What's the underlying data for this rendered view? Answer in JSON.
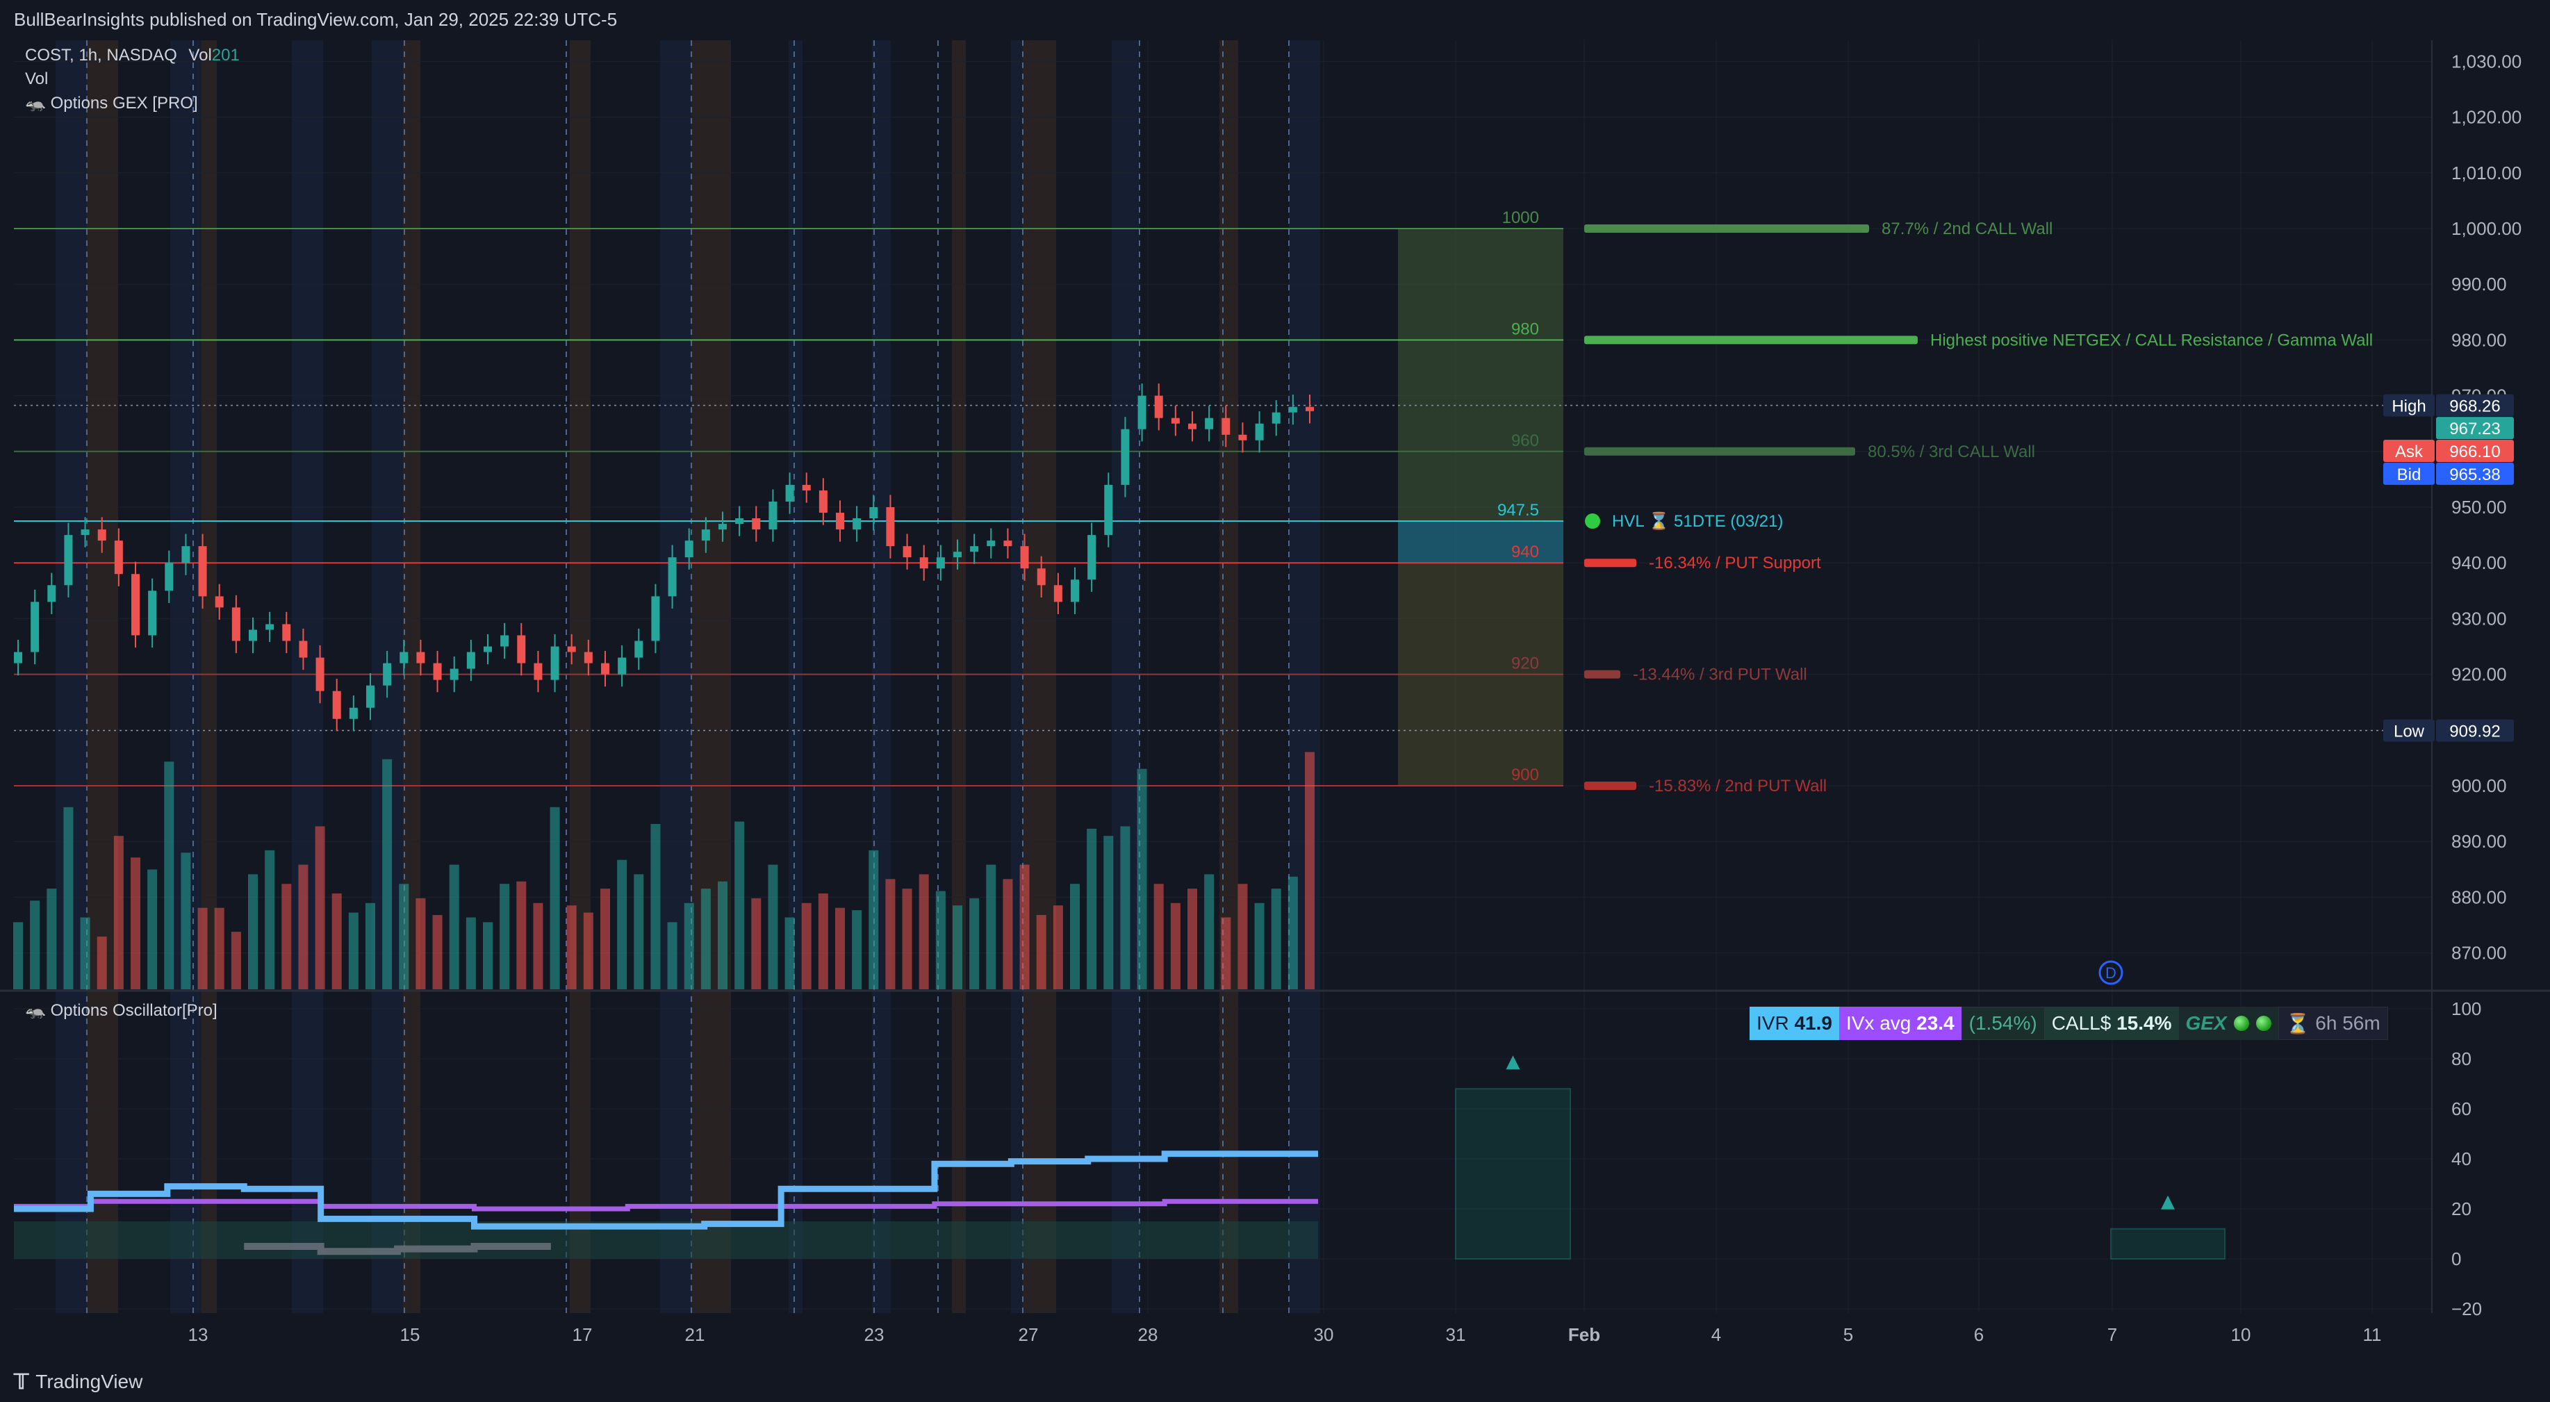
{
  "header": {
    "published_text": "BullBearInsights published on TradingView.com, Jan 29, 2025 22:39 UTC-5"
  },
  "legend": {
    "symbol": "COST, 1h, NASDAQ",
    "vol_label": "Vol",
    "vol_value": "201",
    "vol_line": "Vol",
    "indicator1": "Options GEX [PRO]",
    "indicator2": "Options Oscillator[Pro]"
  },
  "footer": {
    "brand": "TradingView"
  },
  "price_badges": {
    "high_label": "High",
    "high_value": "968.26",
    "last_value": "967.23",
    "ask_label": "Ask",
    "ask_value": "966.10",
    "bid_label": "Bid",
    "bid_value": "965.38",
    "low_label": "Low",
    "low_value": "909.92"
  },
  "gex_levels": [
    {
      "price": 1000,
      "label": "1000",
      "note": "87.7% / 2nd CALL Wall",
      "color": "#4a8a4a"
    },
    {
      "price": 980,
      "label": "980",
      "note": "Highest positive NETGEX / CALL Resistance / Gamma Wall",
      "color": "#4caf50"
    },
    {
      "price": 960,
      "label": "960",
      "note": "80.5% / 3rd CALL Wall",
      "color": "#3d6b43"
    },
    {
      "price": 947.5,
      "label": "947.5",
      "note": "HVL ⌛ 51DTE (03/21)",
      "color": "#26c6da"
    },
    {
      "price": 940,
      "label": "940",
      "note": "-16.34% / PUT Support",
      "color": "#e53935"
    },
    {
      "price": 920,
      "label": "920",
      "note": "-13.44% / 3rd PUT Wall",
      "color": "#8e3a3a"
    },
    {
      "price": 900,
      "label": "900",
      "note": "-15.83% / 2nd PUT Wall",
      "color": "#b03030"
    }
  ],
  "info_strip": {
    "ivr_label": "IVR",
    "ivr_value": "41.9",
    "ivx_label": "IVx avg",
    "ivx_value": "23.4",
    "pct": "(1.54%)",
    "call_label": "CALL$",
    "call_value": "15.4%",
    "gex_label": "GEX",
    "timer": "6h 56m"
  },
  "colors": {
    "bg": "#131722",
    "up": "#26a69a",
    "down": "#ef5350",
    "iv_line": "#64b5f6",
    "ivx_line": "#a65ee8",
    "grid": "#1e222d"
  },
  "chart_data": [
    {
      "type": "candlestick",
      "title": "COST, 1h, NASDAQ",
      "y_axis": {
        "ylim": [
          860,
          1035
        ],
        "ticks": [
          "870.00",
          "880.00",
          "890.00",
          "900.00",
          "910.00",
          "920.00",
          "930.00",
          "940.00",
          "950.00",
          "960.00",
          "970.00",
          "980.00",
          "990.00",
          "1,000.00",
          "1,010.00",
          "1,020.00",
          "1,030.00"
        ]
      },
      "x_axis": {
        "tick_labels": [
          "13",
          "15",
          "17",
          "21",
          "23",
          "27",
          "28",
          "30",
          "31",
          "Feb",
          "4",
          "5",
          "6",
          "7",
          "10",
          "11"
        ]
      },
      "close_series": [
        924,
        933,
        936,
        945,
        946,
        944,
        938,
        927,
        935,
        940,
        943,
        934,
        932,
        926,
        928,
        929,
        926,
        923,
        917,
        912,
        914,
        918,
        922,
        924,
        922,
        919,
        921,
        924,
        925,
        927,
        922,
        919,
        925,
        924,
        922,
        920,
        923,
        926,
        934,
        941,
        944,
        946,
        947,
        948,
        946,
        951,
        954,
        953,
        949,
        946,
        948,
        950,
        943,
        941,
        939,
        941,
        942,
        943,
        944,
        943,
        939,
        936,
        933,
        937,
        945,
        954,
        964,
        970,
        966,
        965,
        964,
        966,
        963,
        962,
        965,
        967,
        968,
        967.23
      ],
      "volume_series": [
        28,
        37,
        42,
        76,
        30,
        22,
        64,
        55,
        50,
        95,
        57,
        34,
        34,
        24,
        48,
        58,
        44,
        52,
        68,
        40,
        32,
        36,
        96,
        44,
        38,
        31,
        52,
        30,
        28,
        44,
        45,
        36,
        76,
        35,
        32,
        42,
        54,
        48,
        69,
        28,
        36,
        42,
        45,
        70,
        38,
        52,
        30,
        36,
        40,
        34,
        33,
        58,
        46,
        42,
        48,
        41,
        35,
        38,
        52,
        46,
        52,
        31,
        35,
        44,
        67,
        64,
        68,
        92,
        44,
        36,
        42,
        48,
        30,
        44,
        36,
        42,
        47,
        99
      ]
    },
    {
      "type": "line",
      "title": "Options Oscillator[Pro]",
      "ylim": [
        -20,
        100
      ],
      "y_ticks": [
        "100",
        "80",
        "60",
        "40",
        "20",
        "0",
        "−20"
      ],
      "series": [
        {
          "values": [
            20,
            26,
            29,
            28,
            16,
            16,
            13,
            13,
            13,
            14,
            28,
            28,
            38,
            39,
            40,
            42,
            42
          ]
        },
        {
          "values": [
            21,
            23,
            23,
            23,
            21,
            21,
            20,
            20,
            21,
            21,
            21,
            21,
            22,
            22,
            22,
            23,
            23
          ]
        },
        {
          "values": [
            null,
            null,
            null,
            5,
            3,
            4,
            5,
            null,
            null,
            null,
            null,
            null,
            null,
            null,
            null,
            null,
            null
          ]
        }
      ],
      "histogram": [
        {
          "x": "31",
          "value": 68
        },
        {
          "x": "7",
          "value": 12
        }
      ]
    }
  ]
}
